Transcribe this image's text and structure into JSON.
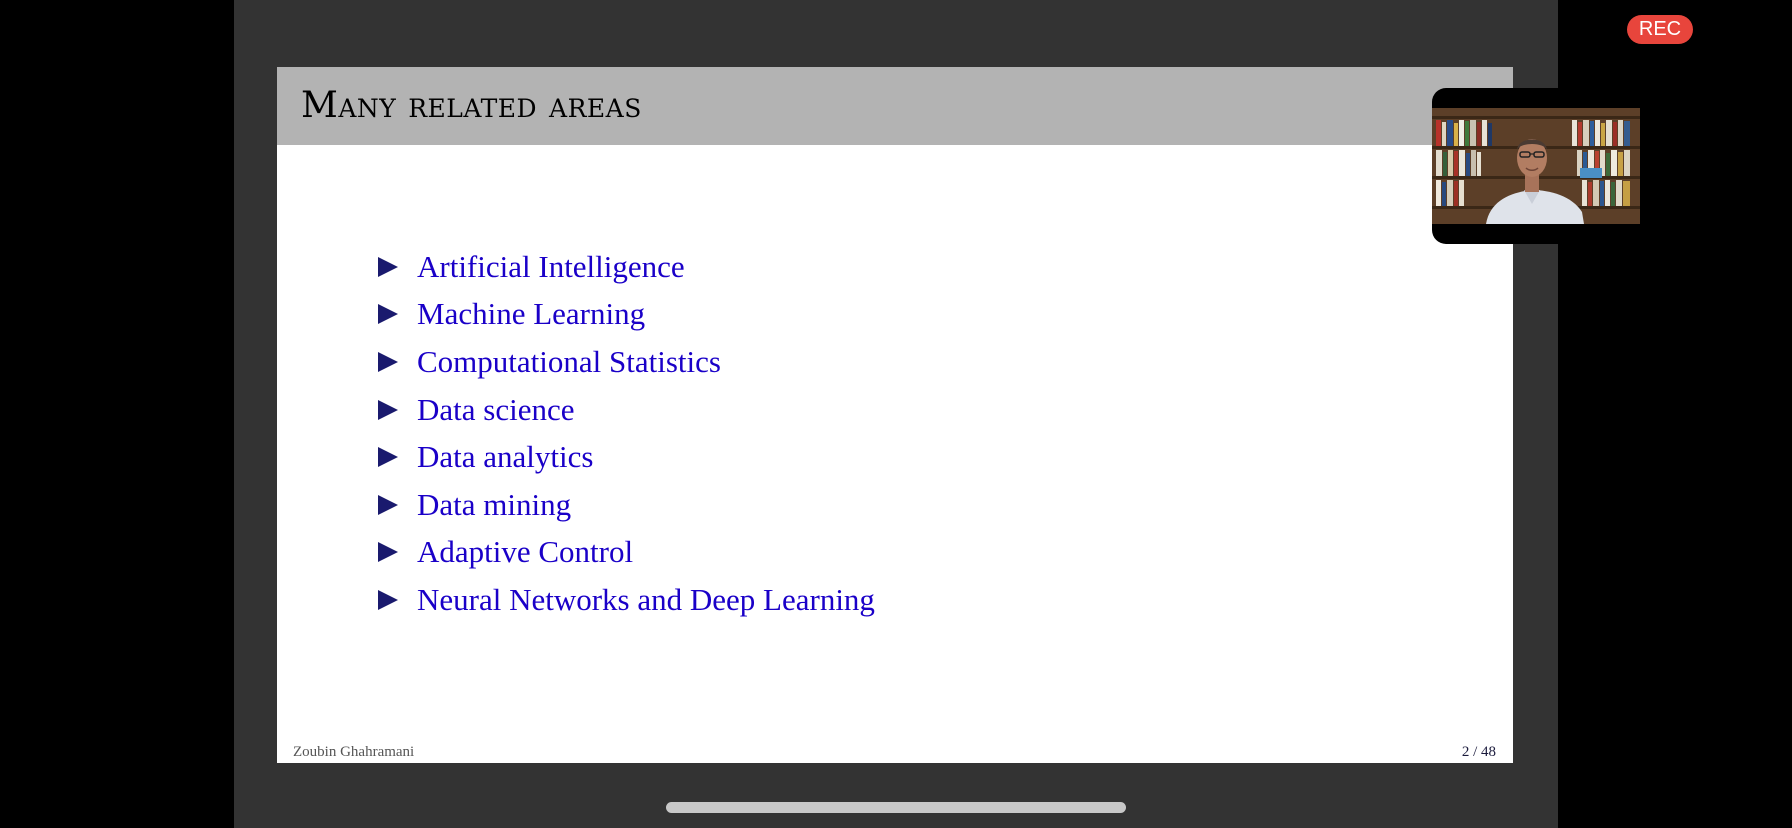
{
  "slide": {
    "title": "Many related areas",
    "bullets": [
      "Artificial Intelligence",
      "Machine Learning",
      "Computational Statistics",
      "Data science",
      "Data analytics",
      "Data mining",
      "Adaptive Control",
      "Neural Networks and Deep Learning"
    ],
    "author": "Zoubin Ghahramani",
    "page": "2 / 48"
  },
  "recording": {
    "label": "REC"
  },
  "colors": {
    "bullet_text": "#1a00c8",
    "bullet_marker": "#1a1a6e",
    "header_band": "#b3b3b3",
    "rec_badge": "#e8453c"
  }
}
